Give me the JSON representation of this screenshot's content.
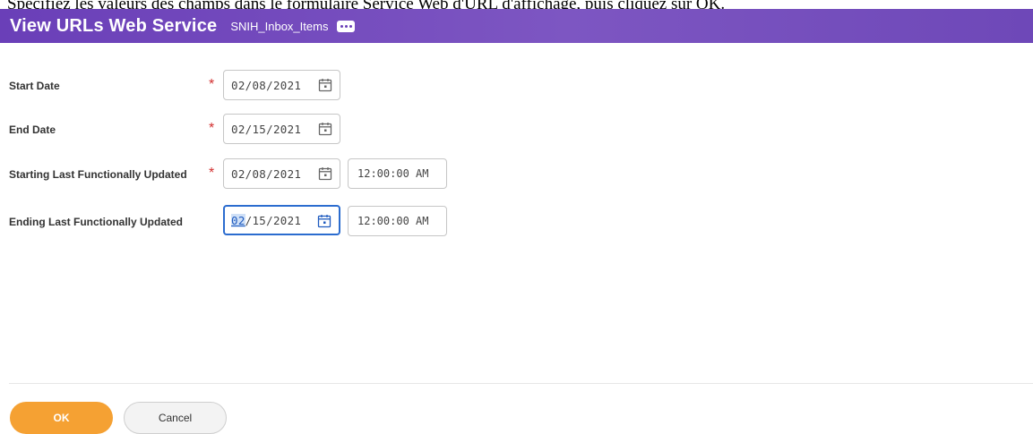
{
  "caption": "Spécifiez les valeurs des champs dans le formulaire Service Web d'URL d'affichage, puis cliquez sur OK.",
  "header": {
    "title": "View URLs Web Service",
    "subtitle": "SNIH_Inbox_Items",
    "more_icon": "more-dots-icon",
    "bg_color": "#7048bb"
  },
  "form": {
    "fields": [
      {
        "label": "Start Date",
        "required": true,
        "date": "02/08/2021"
      },
      {
        "label": "End Date",
        "required": true,
        "date": "02/15/2021"
      },
      {
        "label": "Starting Last Functionally Updated",
        "required": true,
        "date": "02/08/2021",
        "time": "12:00:00 AM"
      },
      {
        "label": "Ending Last Functionally Updated",
        "required": false,
        "date_selected_part": "02",
        "date_rest": "/15/2021",
        "time": "12:00:00 AM",
        "focused": true
      }
    ],
    "required_marker": "*",
    "calendar_icon": "calendar-icon"
  },
  "footer": {
    "ok_label": "OK",
    "cancel_label": "Cancel",
    "ok_color": "#f5a133"
  }
}
